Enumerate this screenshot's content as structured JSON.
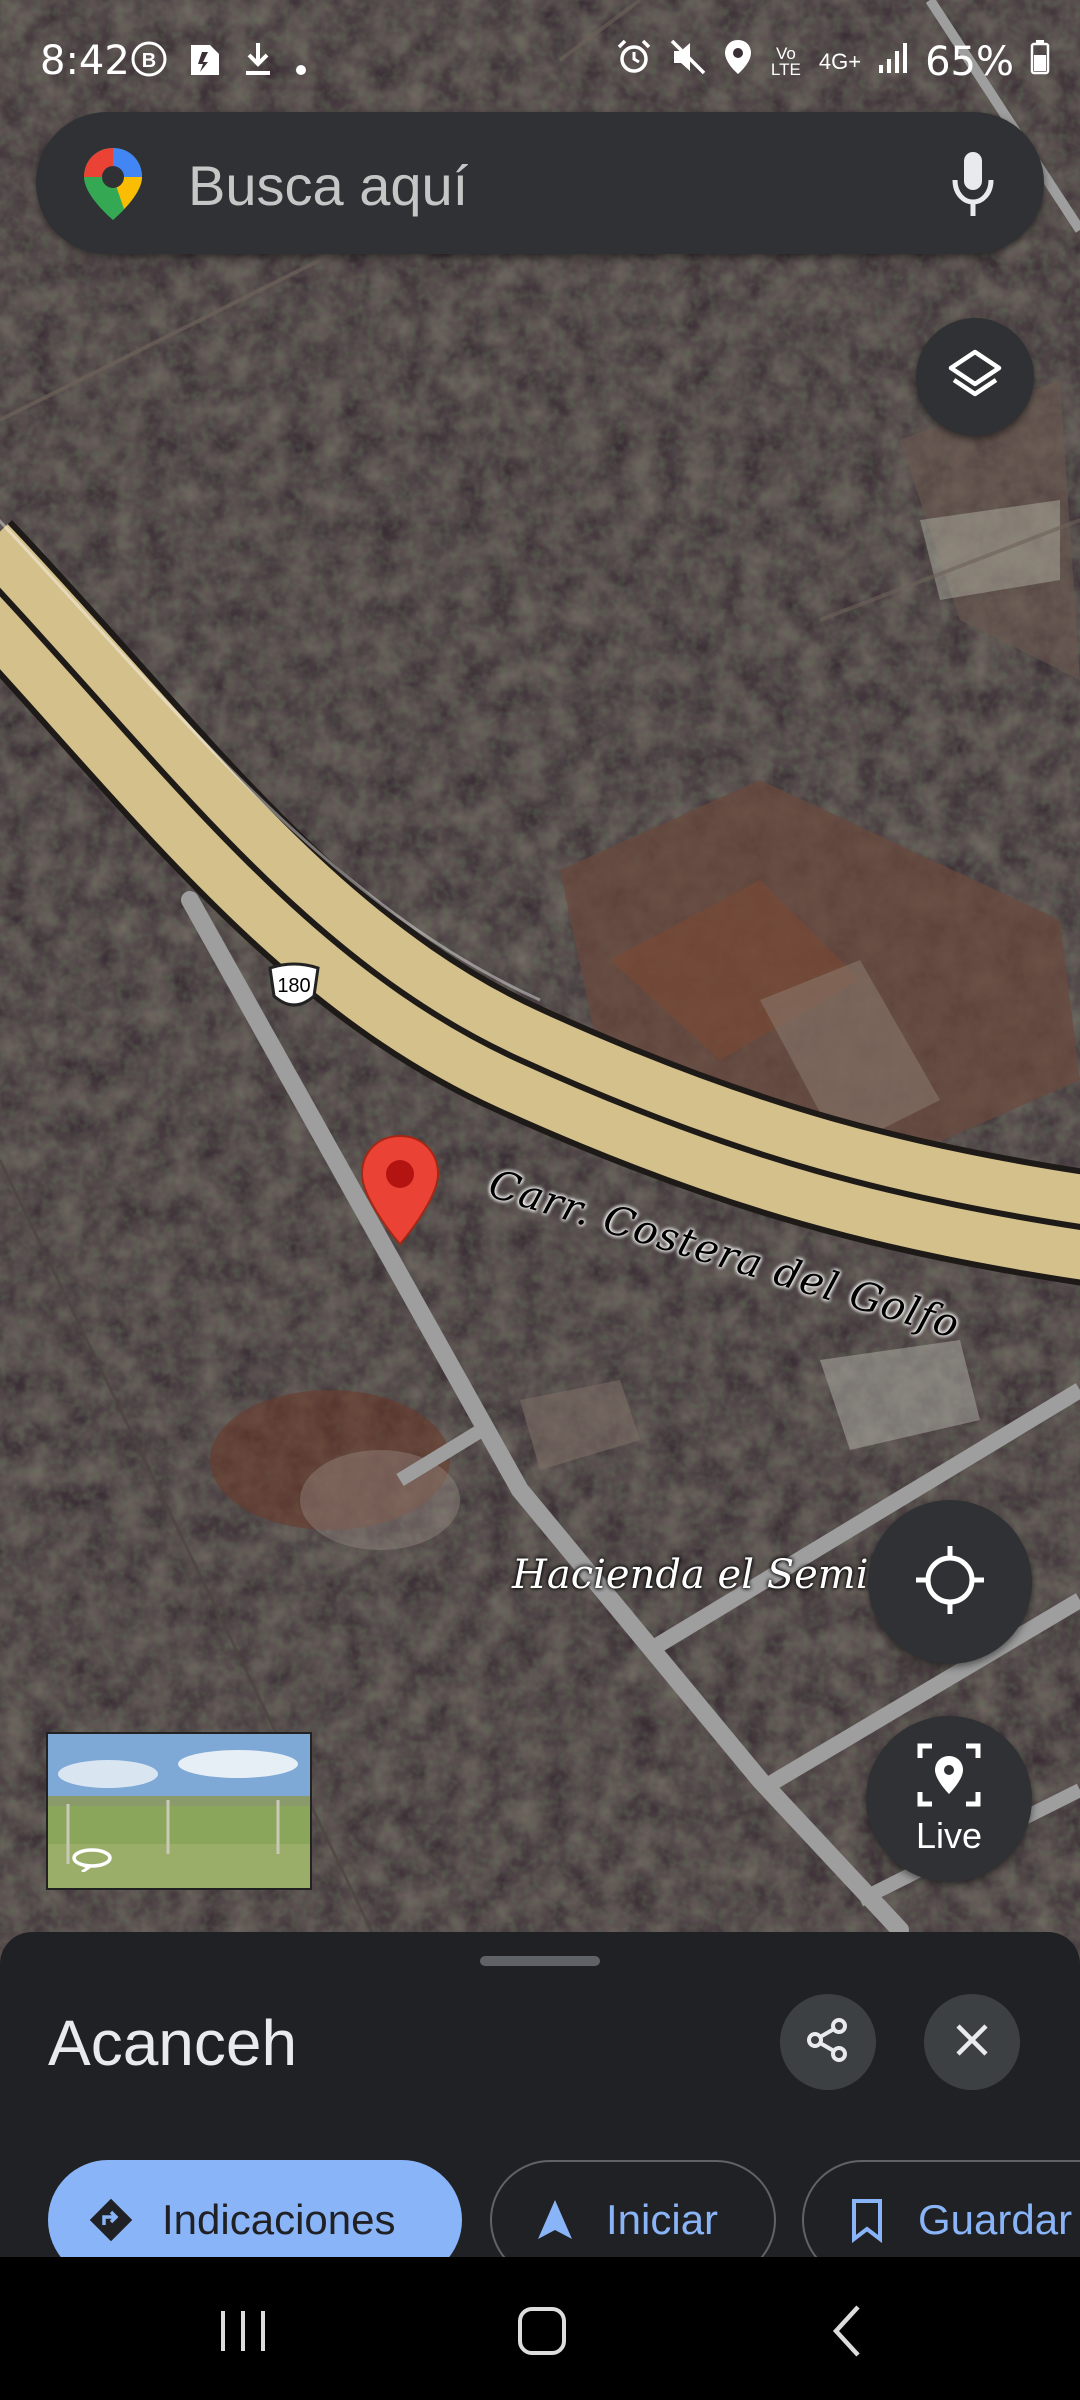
{
  "status_bar": {
    "time": "8:42",
    "battery": "65%",
    "network": "4G+",
    "volte": "Vo LTE",
    "left_icons": [
      "b-badge-icon",
      "sim-note-icon",
      "download-icon",
      "dot-icon"
    ],
    "right_icons": [
      "alarm-icon",
      "mute-icon",
      "location-icon",
      "volte-icon",
      "signal-icon",
      "battery-icon"
    ]
  },
  "search": {
    "placeholder": "Busca aquí",
    "logo": "google-maps-pin-icon",
    "mic": "microphone-icon"
  },
  "map": {
    "type": "satellite",
    "road_label": "Carr. Costera del Golfo",
    "route_shield": "180",
    "place_label": "Hacienda el Semill",
    "pin_color": "#ea4335",
    "road_color": "#d4c08a"
  },
  "controls": {
    "layers_icon": "layers-icon",
    "locate_icon": "my-location-icon",
    "live_label": "Live",
    "live_icon": "live-view-pin-icon"
  },
  "street_view_thumbnail": {
    "icon": "rotate-360-icon"
  },
  "sheet": {
    "title": "Acanceh",
    "share_icon": "share-icon",
    "close_icon": "close-icon",
    "chips": {
      "directions": "Indicaciones",
      "start": "Iniciar",
      "save": "Guardar"
    }
  },
  "colors": {
    "accent": "#8ab4f8",
    "sheet_bg": "#202124",
    "search_bg": "#303134"
  }
}
